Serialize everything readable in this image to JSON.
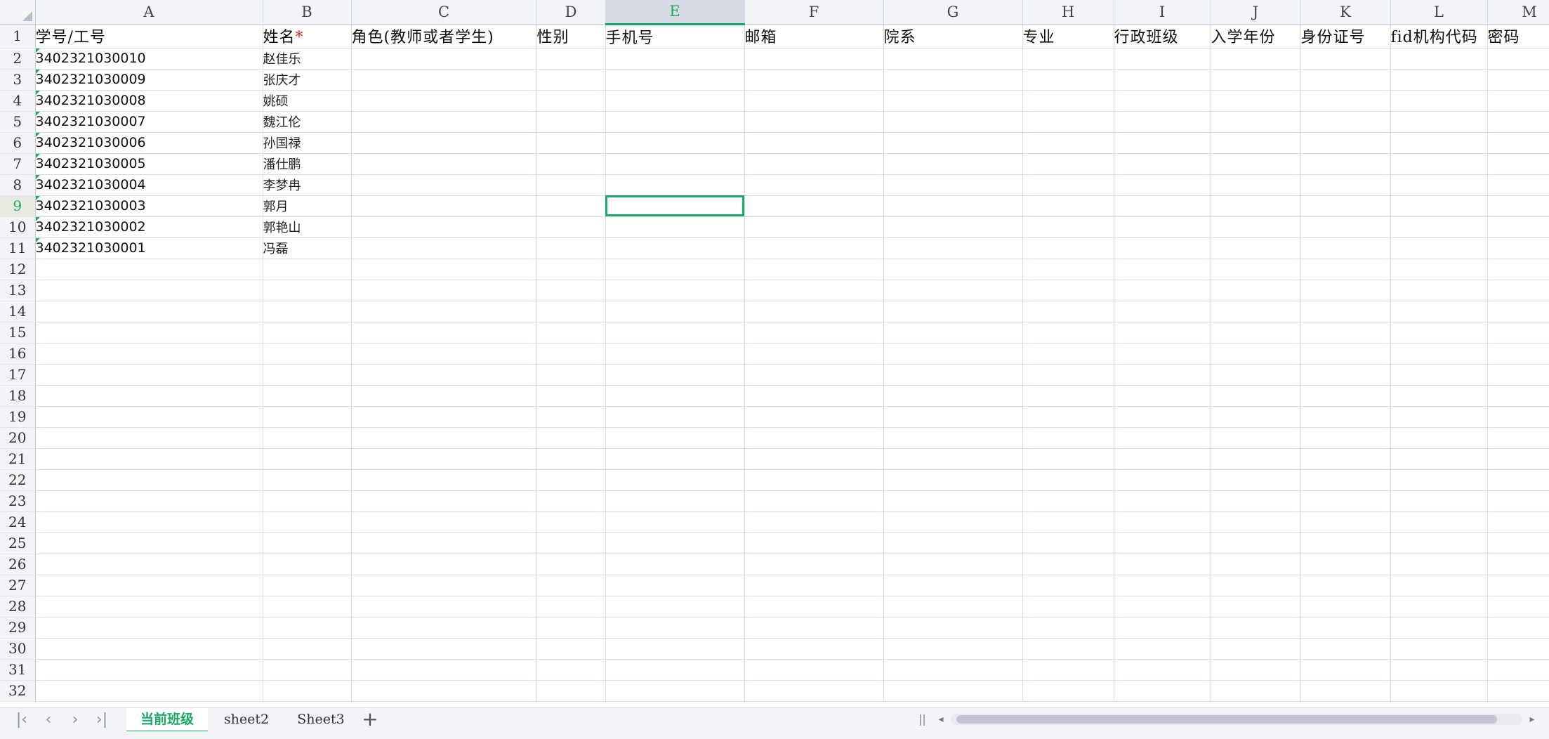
{
  "columns": [
    "A",
    "B",
    "C",
    "D",
    "E",
    "F",
    "G",
    "H",
    "I",
    "J",
    "K",
    "L",
    "M"
  ],
  "selected_column": "E",
  "selected_row": 9,
  "header_row": {
    "id": "学号/工号",
    "name": "姓名",
    "name_required_mark": "*",
    "role": "角色(教师或者学生)",
    "gender": "性别",
    "phone": "手机号",
    "email": "邮箱",
    "department": "院系",
    "major": "专业",
    "admin_class": "行政班级",
    "enroll_year": "入学年份",
    "id_card": "身份证号",
    "fid": "fid机构代码",
    "password": "密码"
  },
  "rows": [
    {
      "id": "3402321030010",
      "name": "赵佳乐"
    },
    {
      "id": "3402321030009",
      "name": "张庆才"
    },
    {
      "id": "3402321030008",
      "name": "姚硕"
    },
    {
      "id": "3402321030007",
      "name": "魏江伦"
    },
    {
      "id": "3402321030006",
      "name": "孙国禄"
    },
    {
      "id": "3402321030005",
      "name": "潘仕鹏"
    },
    {
      "id": "3402321030004",
      "name": "李梦冉"
    },
    {
      "id": "3402321030003",
      "name": "郭月"
    },
    {
      "id": "3402321030002",
      "name": "郭艳山"
    },
    {
      "id": "3402321030001",
      "name": "冯磊"
    }
  ],
  "visible_row_count": 32,
  "sheet_tabs": [
    {
      "label": "当前班级",
      "active": true
    },
    {
      "label": "sheet2",
      "active": false
    },
    {
      "label": "Sheet3",
      "active": false
    }
  ],
  "nav_icons": [
    "first-sheet-icon",
    "prev-sheet-icon",
    "next-sheet-icon",
    "last-sheet-icon"
  ],
  "add_sheet_symbol": "+",
  "accent_color": "#1aa865"
}
